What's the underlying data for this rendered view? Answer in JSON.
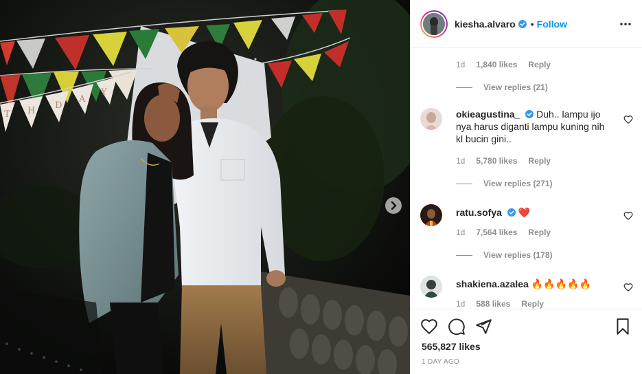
{
  "post": {
    "author": "kiesha.alvaro",
    "separator": "•",
    "follow_label": "Follow",
    "total_likes": "565,827 likes",
    "time_ago": "1 DAY AGO",
    "photo_banner_letters": [
      "T",
      "H",
      "D",
      "A",
      "Y"
    ]
  },
  "comments": [
    {
      "meta": {
        "time": "1d",
        "likes": "1,840 likes",
        "reply": "Reply"
      },
      "view_replies": "View replies (21)"
    },
    {
      "username": "okieagustina_",
      "text": "Duh.. lampu ijo nya harus diganti lampu kuning nih kl bucin gini..",
      "meta": {
        "time": "1d",
        "likes": "5,780 likes",
        "reply": "Reply"
      },
      "view_replies": "View replies (271)"
    },
    {
      "username": "ratu.sofya",
      "text": "❤️",
      "meta": {
        "time": "1d",
        "likes": "7,564 likes",
        "reply": "Reply"
      },
      "view_replies": "View replies (178)"
    },
    {
      "username": "shakiena.azalea",
      "text": "🔥🔥🔥🔥🔥",
      "meta": {
        "time": "1d",
        "likes": "588 likes",
        "reply": "Reply"
      }
    }
  ],
  "colors": {
    "link": "#0095f6",
    "muted": "#8e8e8e",
    "text": "#262626",
    "verified": "#3897f0",
    "border": "#efefef"
  },
  "icons": {
    "header": [
      "verified-badge-icon",
      "more-options-icon"
    ],
    "media": [
      "next-arrow-icon"
    ],
    "actions": [
      "heart-icon",
      "comment-icon",
      "share-icon",
      "bookmark-icon"
    ],
    "comments": [
      "heart-outline-icon"
    ]
  }
}
